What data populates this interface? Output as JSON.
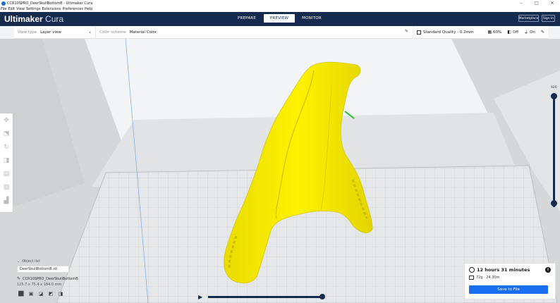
{
  "window": {
    "title": "CCR10SPRO_DeerSkullBottomB - Ultimaker Cura",
    "controls": [
      "–",
      "□",
      "✕"
    ]
  },
  "menu": [
    "File",
    "Edit",
    "View",
    "Settings",
    "Extensions",
    "Preferences",
    "Help"
  ],
  "header": {
    "logo_bold": "Ultimaker",
    "logo_light": "Cura",
    "tabs": [
      {
        "label": "PREPARE",
        "active": false
      },
      {
        "label": "PREVIEW",
        "active": true
      },
      {
        "label": "MONITOR",
        "active": false
      }
    ],
    "marketplace_label": "Marketplace",
    "signin_label": "Sign in"
  },
  "view_panel": {
    "view_type_label": "View type",
    "view_type_value": "Layer view",
    "color_scheme_label": "Color scheme",
    "color_scheme_value": "Material Color"
  },
  "print_settings": {
    "profile": "Standard Quality - 0.2mm",
    "infill": "60%",
    "support": "Off",
    "adhesion": "On"
  },
  "layer_slider": {
    "top_value": "920"
  },
  "object_list": {
    "header": "Object list",
    "item": "DeerSkullBottomB.stl",
    "file": "CCR10SPRO_DeerSkullBottomB",
    "dimensions": "125.7 x 75.4 x 184.0 mm"
  },
  "print_info": {
    "time": "12 hours 31 minutes",
    "material": "72g · 24.30m",
    "save_label": "Save to File"
  },
  "colors": {
    "header_bg": "#162a4d",
    "model_yellow": "#f5e800",
    "accent_blue": "#196ef0"
  }
}
